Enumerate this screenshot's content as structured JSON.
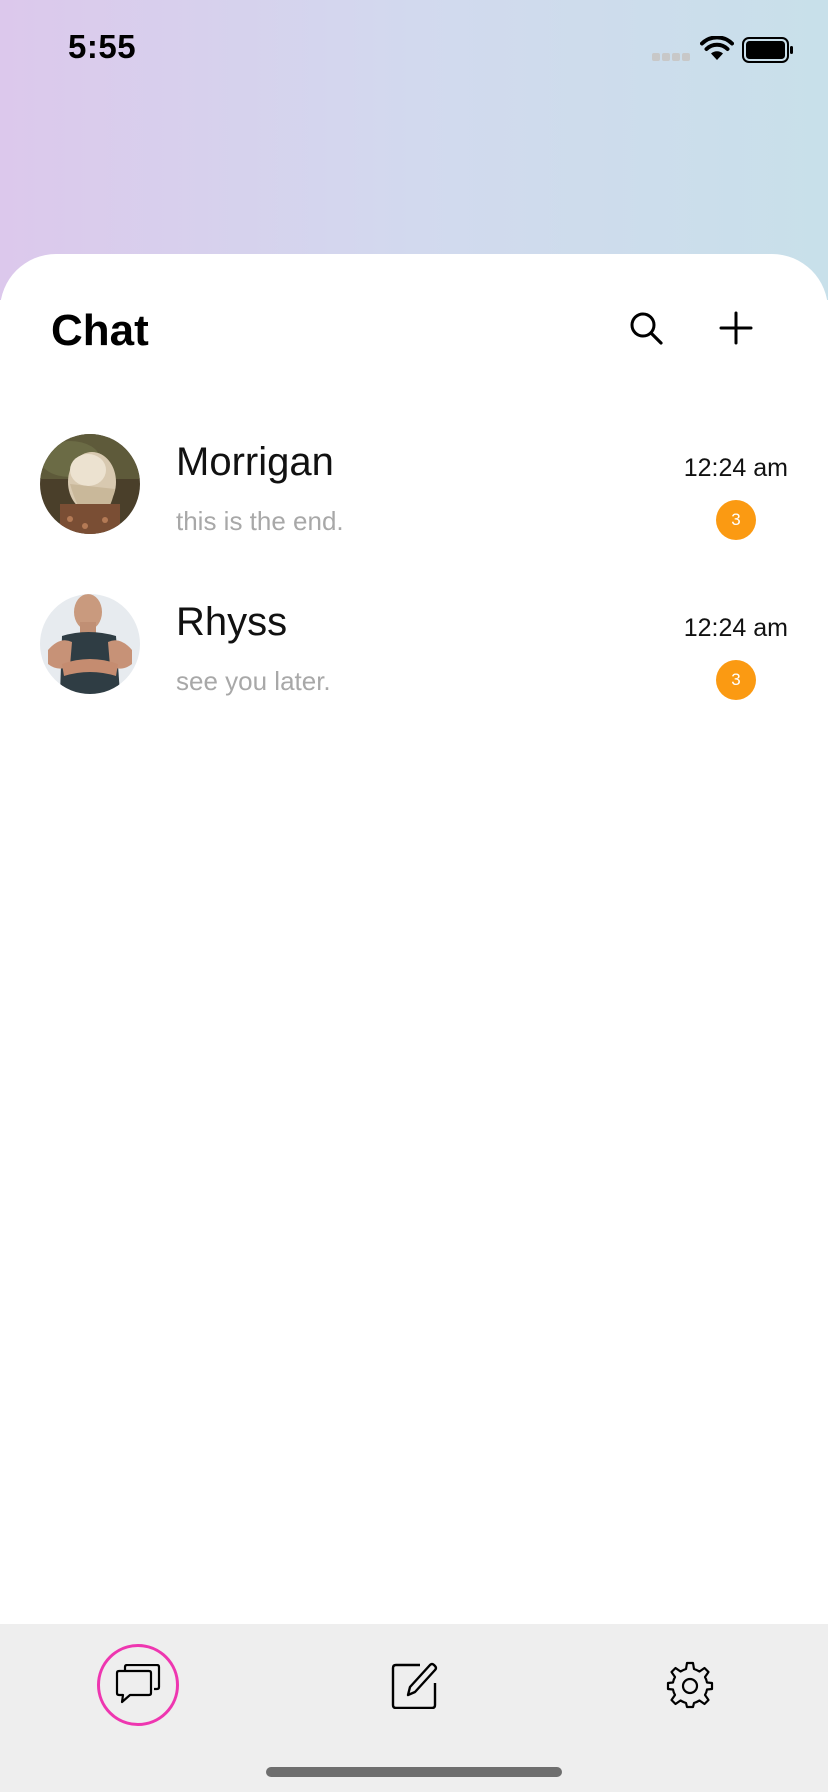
{
  "status_bar": {
    "time": "5:55",
    "icons": [
      "cellular-signal-icon",
      "wifi-icon",
      "battery-icon"
    ]
  },
  "header": {
    "title": "Chat",
    "actions": [
      "search-icon",
      "plus-icon"
    ]
  },
  "chats": [
    {
      "name": "Morrigan",
      "preview": "this is the end.",
      "time": "12:24 am",
      "unread": "3"
    },
    {
      "name": "Rhyss",
      "preview": "see you later.",
      "time": "12:24 am",
      "unread": "3"
    }
  ],
  "tab_bar": {
    "tabs": [
      "chat-bubbles-icon",
      "compose-icon",
      "gear-icon"
    ],
    "active": "chat-bubbles-icon"
  },
  "colors": {
    "badge": "#fb9a12",
    "active_tab_ring": "#ee36b0",
    "gradient_left": "#dcc8ec",
    "gradient_right": "#c8e0ea",
    "preview_text": "#a8a8a8",
    "tab_bar_bg": "#eeeeee"
  }
}
